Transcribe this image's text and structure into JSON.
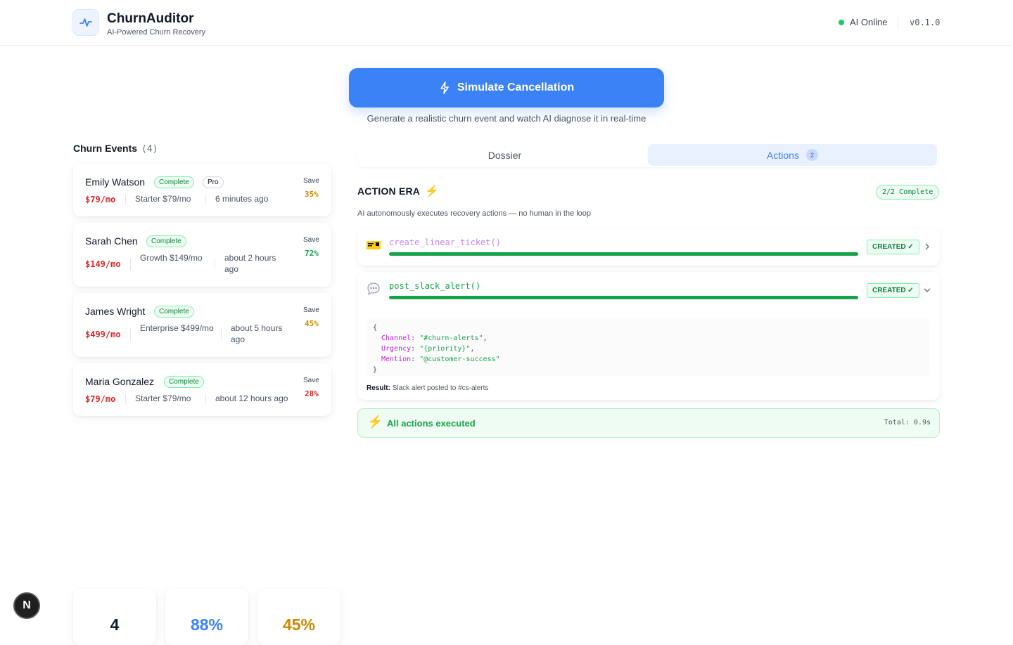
{
  "header": {
    "app_name": "ChurnAuditor",
    "tagline": "AI-Powered Churn Recovery",
    "status_text": "AI Online",
    "version": "v0.1.0",
    "logo_icon": "activity-pulse-icon"
  },
  "simulate": {
    "button_label": "Simulate Cancellation",
    "hint": "Generate a realistic churn event and watch AI diagnose it in real-time"
  },
  "events": {
    "title": "Churn Events",
    "count": "(4)",
    "items": [
      {
        "name": "Emily Watson",
        "status": "Complete",
        "plan_badge": "Pro",
        "mrr": "$79/mo",
        "plan": "Starter $79/mo",
        "time": "6 minutes ago",
        "save_label": "Save",
        "save": "35%"
      },
      {
        "name": "Sarah Chen",
        "status": "Complete",
        "mrr": "$149/mo",
        "plan": "Growth $149/mo",
        "time": "about 2 hours ago",
        "save_label": "Save",
        "save": "72%"
      },
      {
        "name": "James Wright",
        "status": "Complete",
        "mrr": "$499/mo",
        "plan": "Enterprise $499/mo",
        "time": "about 5 hours ago",
        "save_label": "Save",
        "save": "45%"
      },
      {
        "name": "Maria Gonzalez",
        "status": "Complete",
        "mrr": "$79/mo",
        "plan": "Starter $79/mo",
        "time": "about 12 hours ago",
        "save_label": "Save",
        "save": "28%"
      }
    ]
  },
  "tabs": {
    "dossier": "Dossier",
    "actions": "Actions",
    "actions_count": "2"
  },
  "action_era": {
    "title": "ACTION ERA",
    "progress": "2/2 Complete",
    "subtitle": "AI autonomously executes recovery actions — no human in the loop",
    "actions": [
      {
        "fn": "create_linear_ticket()",
        "status": "CREATED ✓",
        "icon": "ticket-icon"
      },
      {
        "fn": "post_slack_alert()",
        "status": "CREATED ✓",
        "icon": "speech-bubble-icon",
        "code": {
          "open": "{",
          "channel_key": "Channel",
          "channel_val": "\"#churn-alerts\"",
          "urgency_key": "Urgency",
          "urgency_val": "\"{priority}\"",
          "mention_key": "Mention",
          "mention_val": "\"@customer-success\"",
          "close": "}"
        },
        "result_label": "Result:",
        "result_text": "Slack alert posted to #cs-alerts"
      }
    ],
    "done_text": "All actions executed",
    "total": "Total: 0.9s"
  },
  "stats": [
    {
      "value": "4",
      "color": "#111827"
    },
    {
      "value": "88%",
      "color": "#3b82f6"
    },
    {
      "value": "45%",
      "color": "#ca8a04"
    }
  ],
  "colors": {
    "accent": "#3b82f6",
    "success": "#16a34a",
    "danger": "#dc2626",
    "warning": "#ca8a04"
  },
  "dev_badge": "N"
}
